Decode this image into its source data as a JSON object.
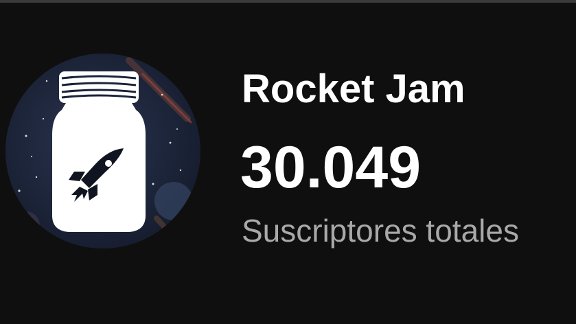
{
  "channel": {
    "name": "Rocket Jam",
    "subscriber_count": "30.049",
    "subscriber_label": "Suscriptores totales",
    "avatar_icon": "rocket-in-jar-icon"
  },
  "colors": {
    "background": "#0f0f0f",
    "primary_text": "#ffffff",
    "secondary_text": "#a9a9a9",
    "avatar_space": "#1a2238"
  }
}
